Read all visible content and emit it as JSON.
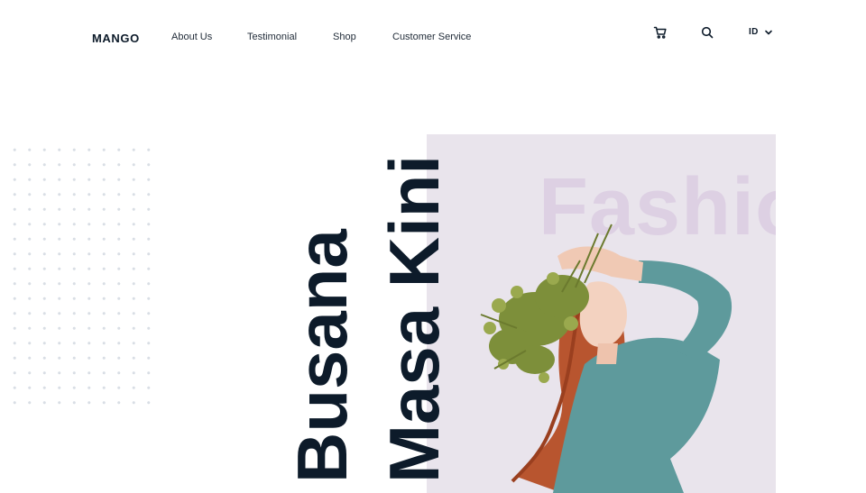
{
  "brand": {
    "logo": "MANGO"
  },
  "nav": {
    "items": [
      {
        "label": "About Us"
      },
      {
        "label": "Testimonial"
      },
      {
        "label": "Shop"
      },
      {
        "label": "Customer Service"
      }
    ]
  },
  "header_actions": {
    "cart_icon": "cart-icon",
    "search_icon": "search-icon",
    "language": "ID",
    "language_icon": "chevron-down-icon"
  },
  "hero": {
    "headline_line1": "Busana",
    "headline_line2": "Masa Kini",
    "background_word": "Fashio",
    "panel_color": "#e9e4ec",
    "headline_color": "#0d1b2a",
    "background_word_color": "#ddd0e3"
  }
}
